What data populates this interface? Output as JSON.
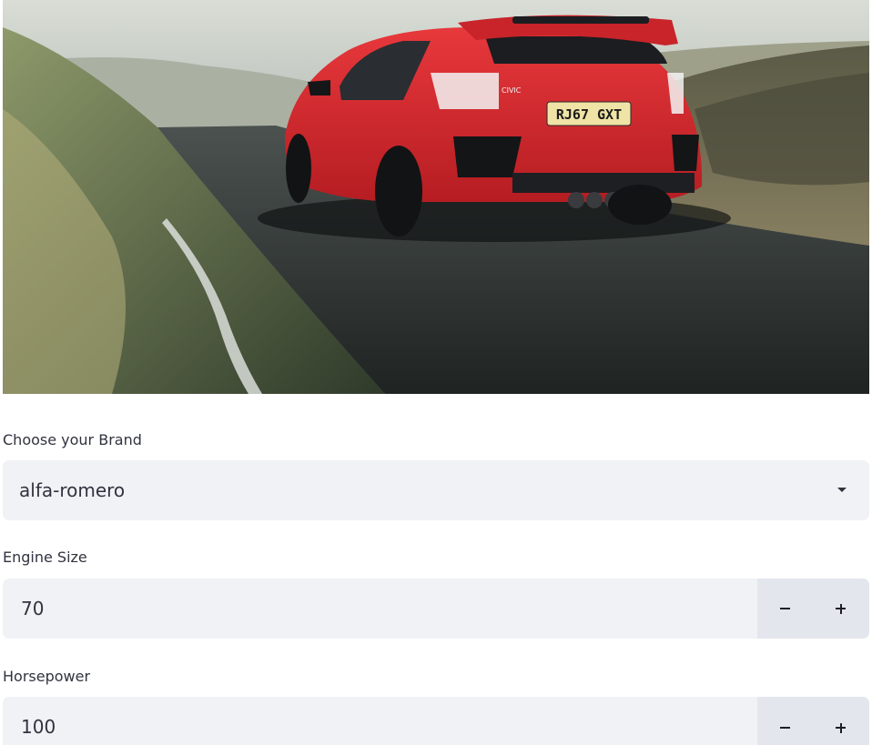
{
  "hero": {
    "alt": "Red Honda Civic hatchback on a wet country road",
    "plate_text": "RJ67 GXT",
    "badge_text": "CIVIC"
  },
  "brand": {
    "label": "Choose your Brand",
    "selected": "alfa-romero",
    "icon": "chevron-down-icon"
  },
  "engine_size": {
    "label": "Engine Size",
    "value": "70",
    "decrement_icon": "minus-icon",
    "increment_icon": "plus-icon"
  },
  "horsepower": {
    "label": "Horsepower",
    "value": "100",
    "decrement_icon": "minus-icon",
    "increment_icon": "plus-icon"
  },
  "colors": {
    "input_bg": "#f0f2f6",
    "stepper_bg": "#e3e6ec",
    "text": "#31333f",
    "car_red": "#d8262b"
  }
}
